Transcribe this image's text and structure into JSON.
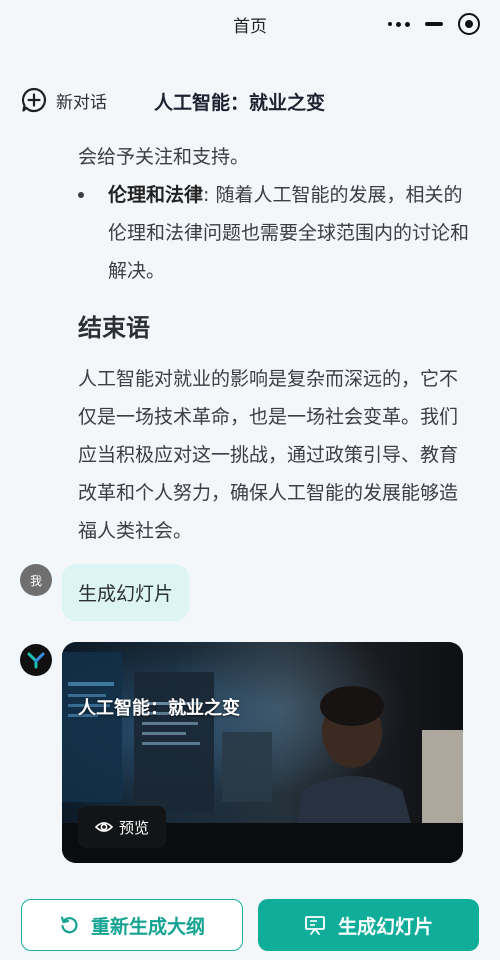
{
  "topbar": {
    "title": "首页"
  },
  "chat": {
    "new_chat_label": "新对话",
    "title": "人工智能：就业之变"
  },
  "article": {
    "line_top": "会给予关注和支持。",
    "bullet": {
      "bold": "伦理和法律",
      "text": ": 随着人工智能的发展，相关的伦理和法律问题也需要全球范围内的讨论和解决。"
    },
    "heading": "结束语",
    "conclusion": "人工智能对就业的影响是复杂而深远的，它不仅是一场技术革命，也是一场社会变革。我们应当积极应对这一挑战，通过政策引导、教育改革和个人努力，确保人工智能的发展能够造福人类社会。"
  },
  "user_message": {
    "avatar_text": "我",
    "text": "生成幻灯片"
  },
  "slide_card": {
    "title": "人工智能：就业之变",
    "preview_label": "预览"
  },
  "actions": {
    "regenerate_label": "重新生成大纲",
    "generate_label": "生成幻灯片"
  },
  "colors": {
    "accent": "#11ad9b",
    "bubble": "#dcf4f3",
    "background": "#f4f7fa"
  }
}
